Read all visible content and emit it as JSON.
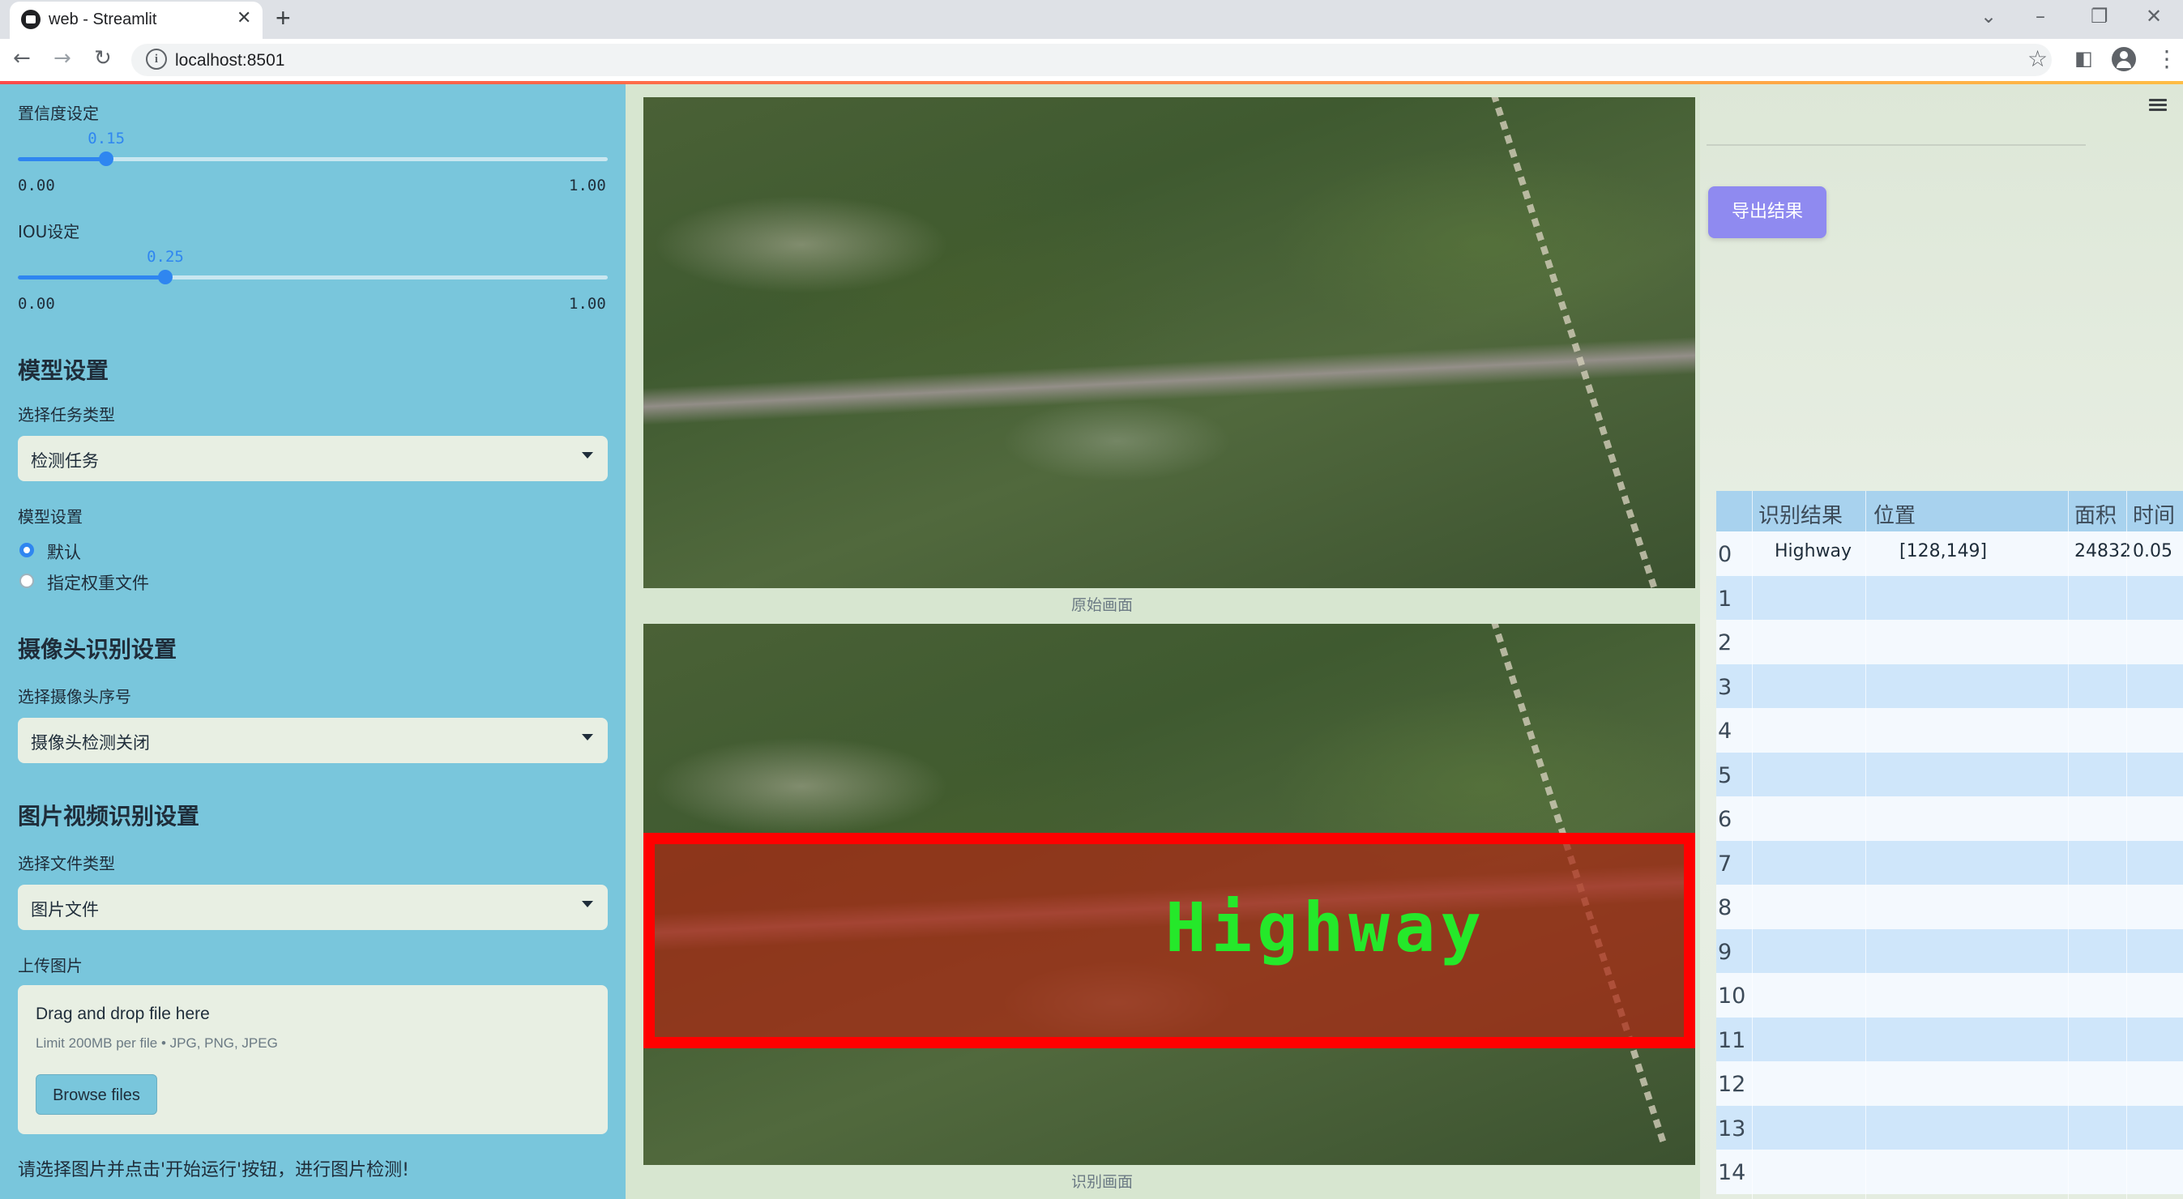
{
  "browser": {
    "tab_title": "web - Streamlit",
    "url": "localhost:8501"
  },
  "sidebar": {
    "confidence": {
      "label": "置信度设定",
      "value": "0.15",
      "min": "0.00",
      "max": "1.00",
      "fraction": 0.15
    },
    "iou": {
      "label": "IOU设定",
      "value": "0.25",
      "min": "0.00",
      "max": "1.00",
      "fraction": 0.25
    },
    "model_heading": "模型设置",
    "task_type_label": "选择任务类型",
    "task_type_value": "检测任务",
    "model_settings_label": "模型设置",
    "model_options": [
      "默认",
      "指定权重文件"
    ],
    "model_selected": 0,
    "camera_heading": "摄像头识别设置",
    "camera_label": "选择摄像头序号",
    "camera_value": "摄像头检测关闭",
    "media_heading": "图片视频识别设置",
    "file_type_label": "选择文件类型",
    "file_type_value": "图片文件",
    "upload_label": "上传图片",
    "upload_title": "Drag and drop file here",
    "upload_limit": "Limit 200MB per file • JPG, PNG, JPEG",
    "browse_label": "Browse files",
    "footer_text": "请选择图片并点击'开始运行'按钮，进行图片检测!"
  },
  "main": {
    "original_caption": "原始画面",
    "result_caption": "识别画面",
    "detection_label": "Highway",
    "export_button": "导出结果"
  },
  "table": {
    "headers": [
      "识别结果",
      "位置",
      "面积",
      "时间"
    ],
    "rows": [
      {
        "index": "0",
        "result": "Highway",
        "position": "[128,149]",
        "area": "24832",
        "time": "0.05"
      },
      {
        "index": "1"
      },
      {
        "index": "2"
      },
      {
        "index": "3"
      },
      {
        "index": "4"
      },
      {
        "index": "5"
      },
      {
        "index": "6"
      },
      {
        "index": "7"
      },
      {
        "index": "8"
      },
      {
        "index": "9"
      },
      {
        "index": "10"
      },
      {
        "index": "11"
      },
      {
        "index": "12"
      },
      {
        "index": "13"
      },
      {
        "index": "14"
      }
    ]
  },
  "colors": {
    "sidebar_bg": "#79c6dc",
    "accent": "#2f86f0",
    "export_button": "#8f8af0",
    "detection_box": "#ff0000",
    "detection_text": "#25e82a"
  }
}
